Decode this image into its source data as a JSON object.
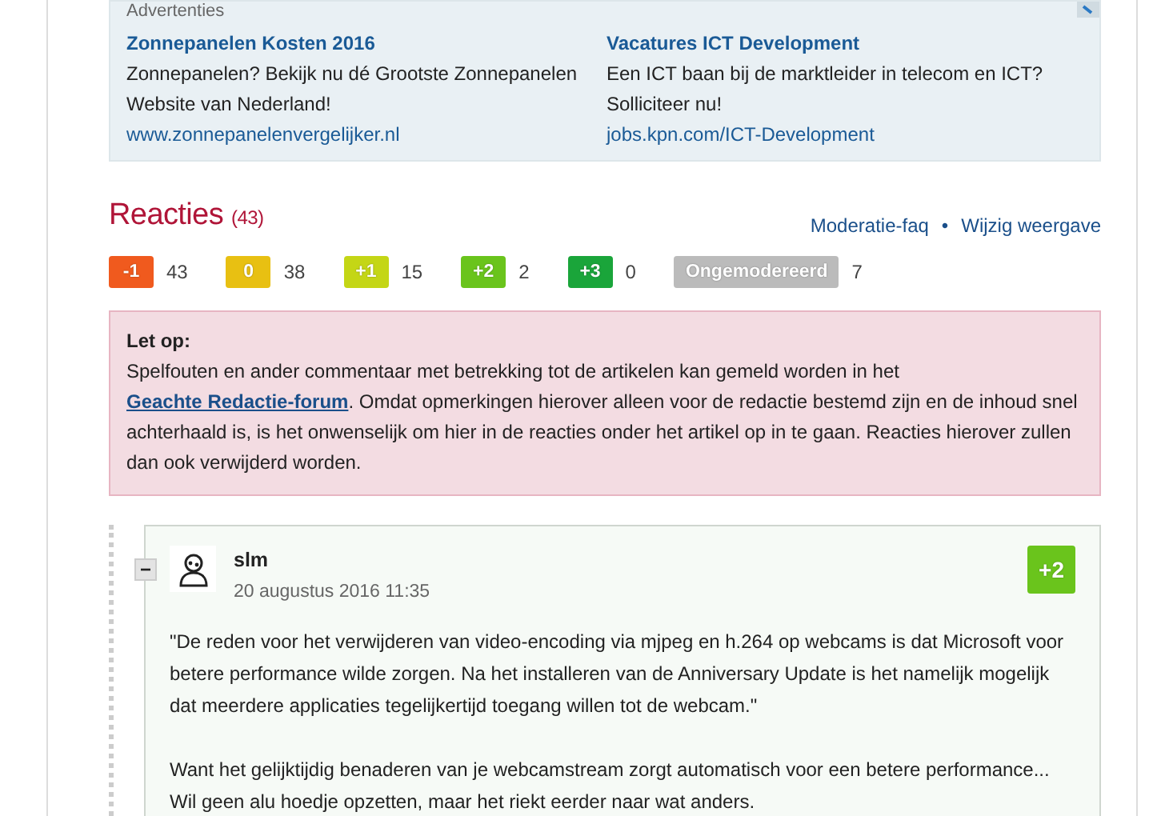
{
  "ads": {
    "label": "Advertenties",
    "items": [
      {
        "title": "Zonnepanelen Kosten 2016",
        "text": "Zonnepanelen? Bekijk nu dé Grootste Zonnepanelen Website van Nederland!",
        "url": "www.zonnepanelenvergelijker.nl"
      },
      {
        "title": "Vacatures ICT Development",
        "text": "Een ICT baan bij de marktleider in telecom en ICT? Solliciteer nu!",
        "url": "jobs.kpn.com/ICT-Development"
      }
    ]
  },
  "reactions": {
    "title": "Reacties",
    "count": "(43)",
    "links": [
      "Moderatie-faq",
      "Wijzig weergave"
    ],
    "separator": "•",
    "filters": [
      {
        "label": "-1",
        "count": "43",
        "color": "#f05a1e"
      },
      {
        "label": "0",
        "count": "38",
        "color": "#e8c012"
      },
      {
        "label": "+1",
        "count": "15",
        "color": "#c4d616"
      },
      {
        "label": "+2",
        "count": "2",
        "color": "#6ac41c"
      },
      {
        "label": "+3",
        "count": "0",
        "color": "#1aa53a"
      },
      {
        "label": "Ongemodereerd",
        "count": "7",
        "color": "#bbbbbb"
      }
    ]
  },
  "notice": {
    "title": "Let op:",
    "text": "Spelfouten en ander commentaar met betrekking tot de artikelen kan gemeld worden in het ",
    "link": "Geachte Redactie-forum",
    "text_after": ". Omdat opmerkingen hierover alleen voor de redactie bestemd zijn en de inhoud snel achterhaald is, is het onwenselijk om hier in de reacties onder het artikel op in te gaan. Reacties hierover zullen dan ook verwijderd worden."
  },
  "comment": {
    "collapse": "−",
    "author": "slm",
    "date": "20 augustus 2016 11:35",
    "score": {
      "label": "+2",
      "color": "#6ac41c"
    },
    "paragraphs": [
      "\"De reden voor het verwijderen van video-encoding via mjpeg en h.264 op webcams is dat Microsoft voor betere performance wilde zorgen. Na het installeren van de Anniversary Update is het namelijk mogelijk dat meerdere applicaties tegelijkertijd toegang willen tot de webcam.\"",
      "Want het gelijktijdig benaderen van je webcamstream zorgt automatisch voor een betere performance... Wil geen alu hoedje opzetten, maar het riekt eerder naar wat anders."
    ]
  }
}
